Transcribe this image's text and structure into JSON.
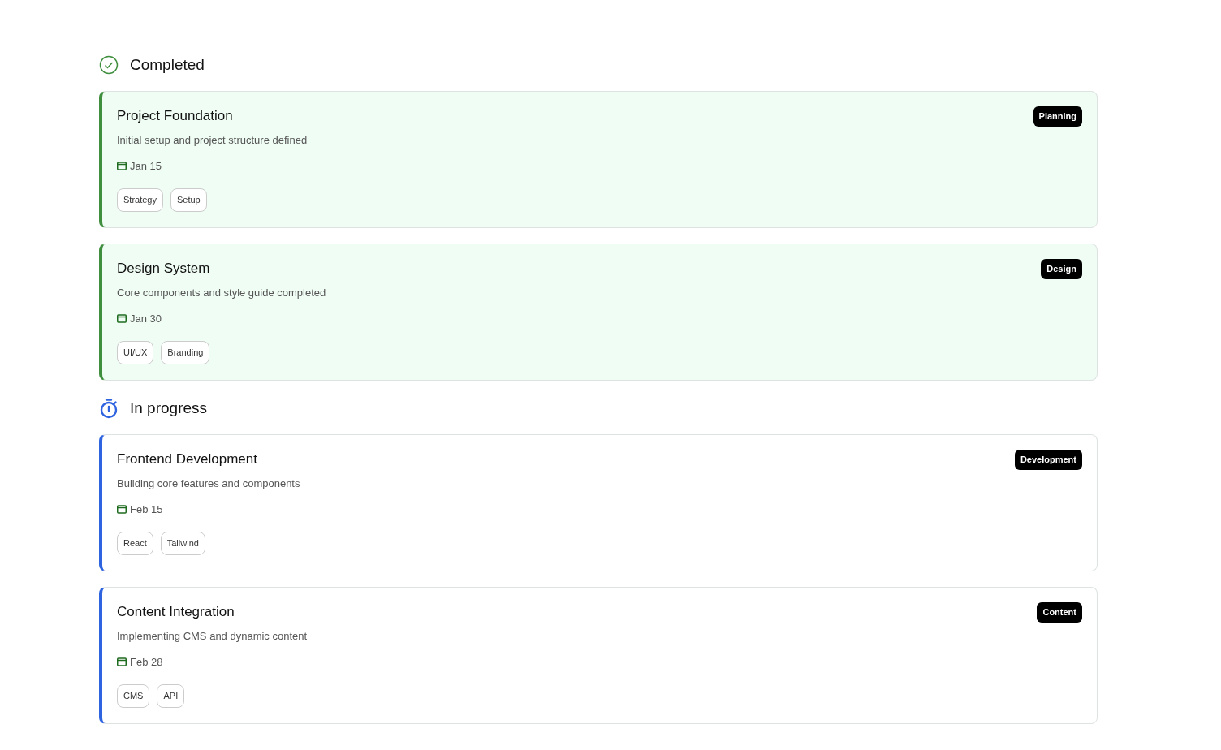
{
  "sections": [
    {
      "kind": "completed",
      "title": "Completed",
      "cards": [
        {
          "title": "Project Foundation",
          "description": "Initial setup and project structure defined",
          "date": "Jan 15",
          "category": "Planning",
          "tags": [
            "Strategy",
            "Setup"
          ]
        },
        {
          "title": "Design System",
          "description": "Core components and style guide completed",
          "date": "Jan 30",
          "category": "Design",
          "tags": [
            "UI/UX",
            "Branding"
          ]
        }
      ]
    },
    {
      "kind": "in_progress",
      "title": "In progress",
      "cards": [
        {
          "title": "Frontend Development",
          "description": "Building core features and components",
          "date": "Feb 15",
          "category": "Development",
          "tags": [
            "React",
            "Tailwind"
          ]
        },
        {
          "title": "Content Integration",
          "description": "Implementing CMS and dynamic content",
          "date": "Feb 28",
          "category": "Content",
          "tags": [
            "CMS",
            "API"
          ]
        }
      ]
    }
  ]
}
